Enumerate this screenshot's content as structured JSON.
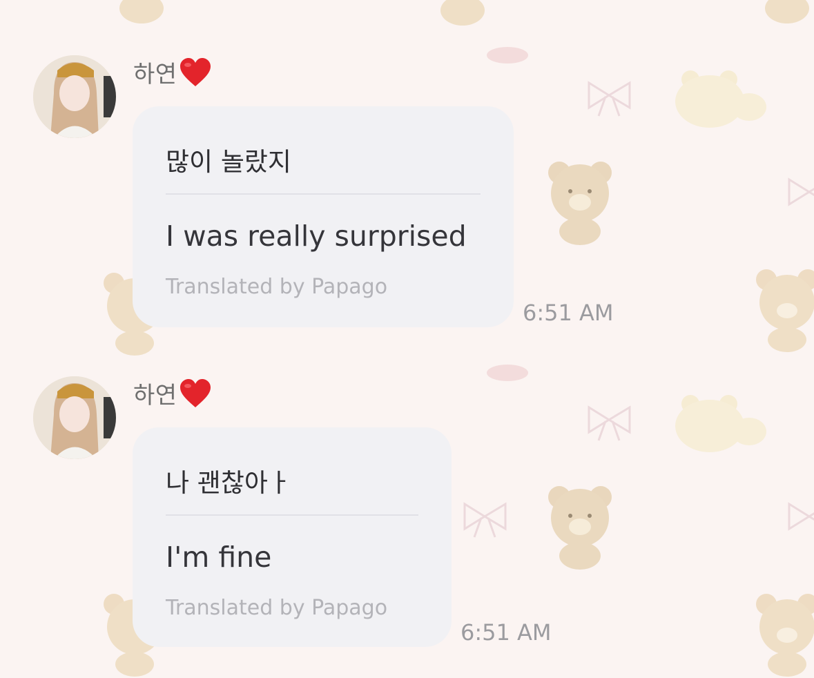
{
  "chat": {
    "messages": [
      {
        "sender": "하연",
        "original": "많이 놀랐지",
        "translation": "I was really surprised",
        "credit": "Translated by Papago",
        "time": "6:51 AM"
      },
      {
        "sender": "하연",
        "original": "나 괜찮아ㅏ",
        "translation": "I'm fine",
        "credit": "Translated by Papago",
        "time": "6:51 AM"
      }
    ]
  },
  "icons": {
    "sender_badge": "red-heart-icon",
    "avatar": "profile-photo"
  },
  "colors": {
    "wallpaper": "#fbf4f2",
    "bubble": "#f1f1f4",
    "heart": "#e3242b",
    "timestamp": "#9b9b9f",
    "credit": "#b3b3b8"
  }
}
